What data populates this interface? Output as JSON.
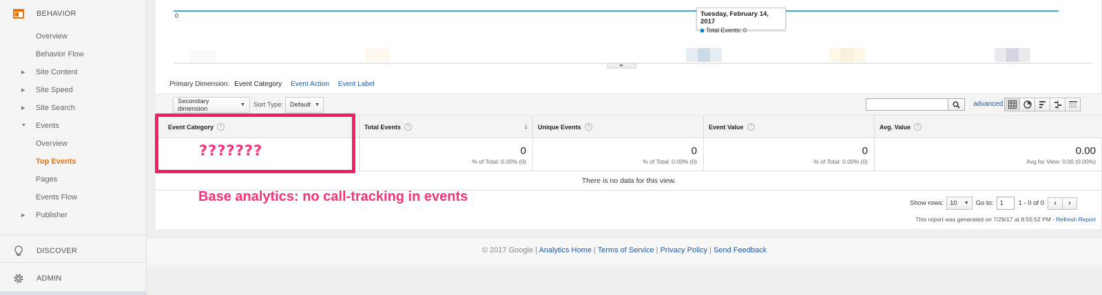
{
  "sidebar": {
    "behavior_label": "BEHAVIOR",
    "items": [
      {
        "label": "Overview"
      },
      {
        "label": "Behavior Flow"
      },
      {
        "label": "Site Content"
      },
      {
        "label": "Site Speed"
      },
      {
        "label": "Site Search"
      },
      {
        "label": "Events"
      },
      {
        "label": "Overview"
      },
      {
        "label": "Top Events"
      },
      {
        "label": "Pages"
      },
      {
        "label": "Events Flow"
      },
      {
        "label": "Publisher"
      }
    ],
    "discover_label": "DISCOVER",
    "admin_label": "ADMIN",
    "accent_color": "#e8710a"
  },
  "chart": {
    "y_tick": "0",
    "tooltip_date": "Tuesday, February 14, 2017",
    "tooltip_metric": "Total Events: 0",
    "line_color": "#058dc7"
  },
  "dimensions": {
    "label": "Primary Dimension:",
    "active": "Event Category",
    "options": [
      "Event Action",
      "Event Label"
    ]
  },
  "toolbar": {
    "secondary_dimension": "Secondary dimension",
    "sort_type_label": "Sort Type:",
    "sort_type_value": "Default",
    "search_placeholder": "",
    "advanced_label": "advanced"
  },
  "table": {
    "headers": [
      "Event Category",
      "Total Events",
      "Unique Events",
      "Event Value",
      "Avg. Value"
    ],
    "totals": [
      {
        "value": "0",
        "sub": "% of Total: 0.00% (0)"
      },
      {
        "value": "0",
        "sub": "% of Total: 0.00% (0)"
      },
      {
        "value": "0",
        "sub": "% of Total: 0.00% (0)"
      },
      {
        "value": "0.00",
        "sub": "Avg for View: 0.00 (0.00%)"
      }
    ],
    "no_data": "There is no data for this view."
  },
  "pager": {
    "show_rows_label": "Show rows:",
    "rows_value": "10",
    "goto_label": "Go to:",
    "goto_value": "1",
    "range": "1 - 0 of 0"
  },
  "report_generated": "This report was generated on 7/29/17 at 8:55:52 PM - ",
  "refresh_label": "Refresh Report",
  "annotation": {
    "question_marks": "???????",
    "note": "Base analytics: no call-tracking in events",
    "color": "#f0206a"
  },
  "footer": {
    "copyright": "© 2017 Google",
    "links": [
      "Analytics Home",
      "Terms of Service",
      "Privacy Policy",
      "Send Feedback"
    ]
  }
}
